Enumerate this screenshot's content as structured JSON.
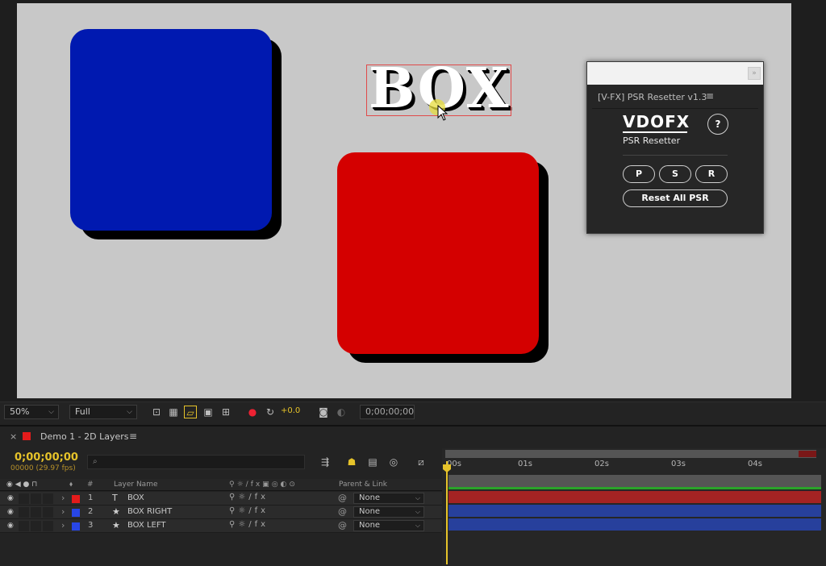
{
  "comp_text": "BOX",
  "colors": {
    "blue_box": "#0019b0",
    "red_box": "#d40000",
    "shadow": "#000000",
    "comp_bg": "#c8c8c8"
  },
  "panel": {
    "title": "[V-FX] PSR Resetter v1.3",
    "menu_icon": "hamburger-icon",
    "brand": "VDOFX",
    "subtitle": "PSR Resetter",
    "help_label": "?",
    "buttons": [
      "P",
      "S",
      "R"
    ],
    "reset_label": "Reset All PSR"
  },
  "viewer_toolbar": {
    "zoom": "50%",
    "resolution": "Full",
    "exposure": "+0.0",
    "timecode": "0;00;00;00"
  },
  "timeline": {
    "tab_label": "Demo 1 - 2D Layers",
    "timecode": "0;00;00;00",
    "fps": "00000 (29.97 fps)",
    "search_placeholder": "",
    "headers": {
      "hash": "#",
      "layer_name": "Layer Name",
      "parent": "Parent & Link"
    },
    "ruler": [
      "00s",
      "01s",
      "02s",
      "03s",
      "04s"
    ],
    "layers": [
      {
        "num": "1",
        "type": "T",
        "name": "BOX",
        "color": "#e31b1b",
        "parent": "None",
        "bar_color": "#a42323"
      },
      {
        "num": "2",
        "type": "★",
        "name": "BOX RIGHT",
        "color": "#2846e6",
        "parent": "None",
        "bar_color": "#27409c"
      },
      {
        "num": "3",
        "type": "★",
        "name": "BOX LEFT",
        "color": "#2846e6",
        "parent": "None",
        "bar_color": "#27409c"
      }
    ]
  }
}
